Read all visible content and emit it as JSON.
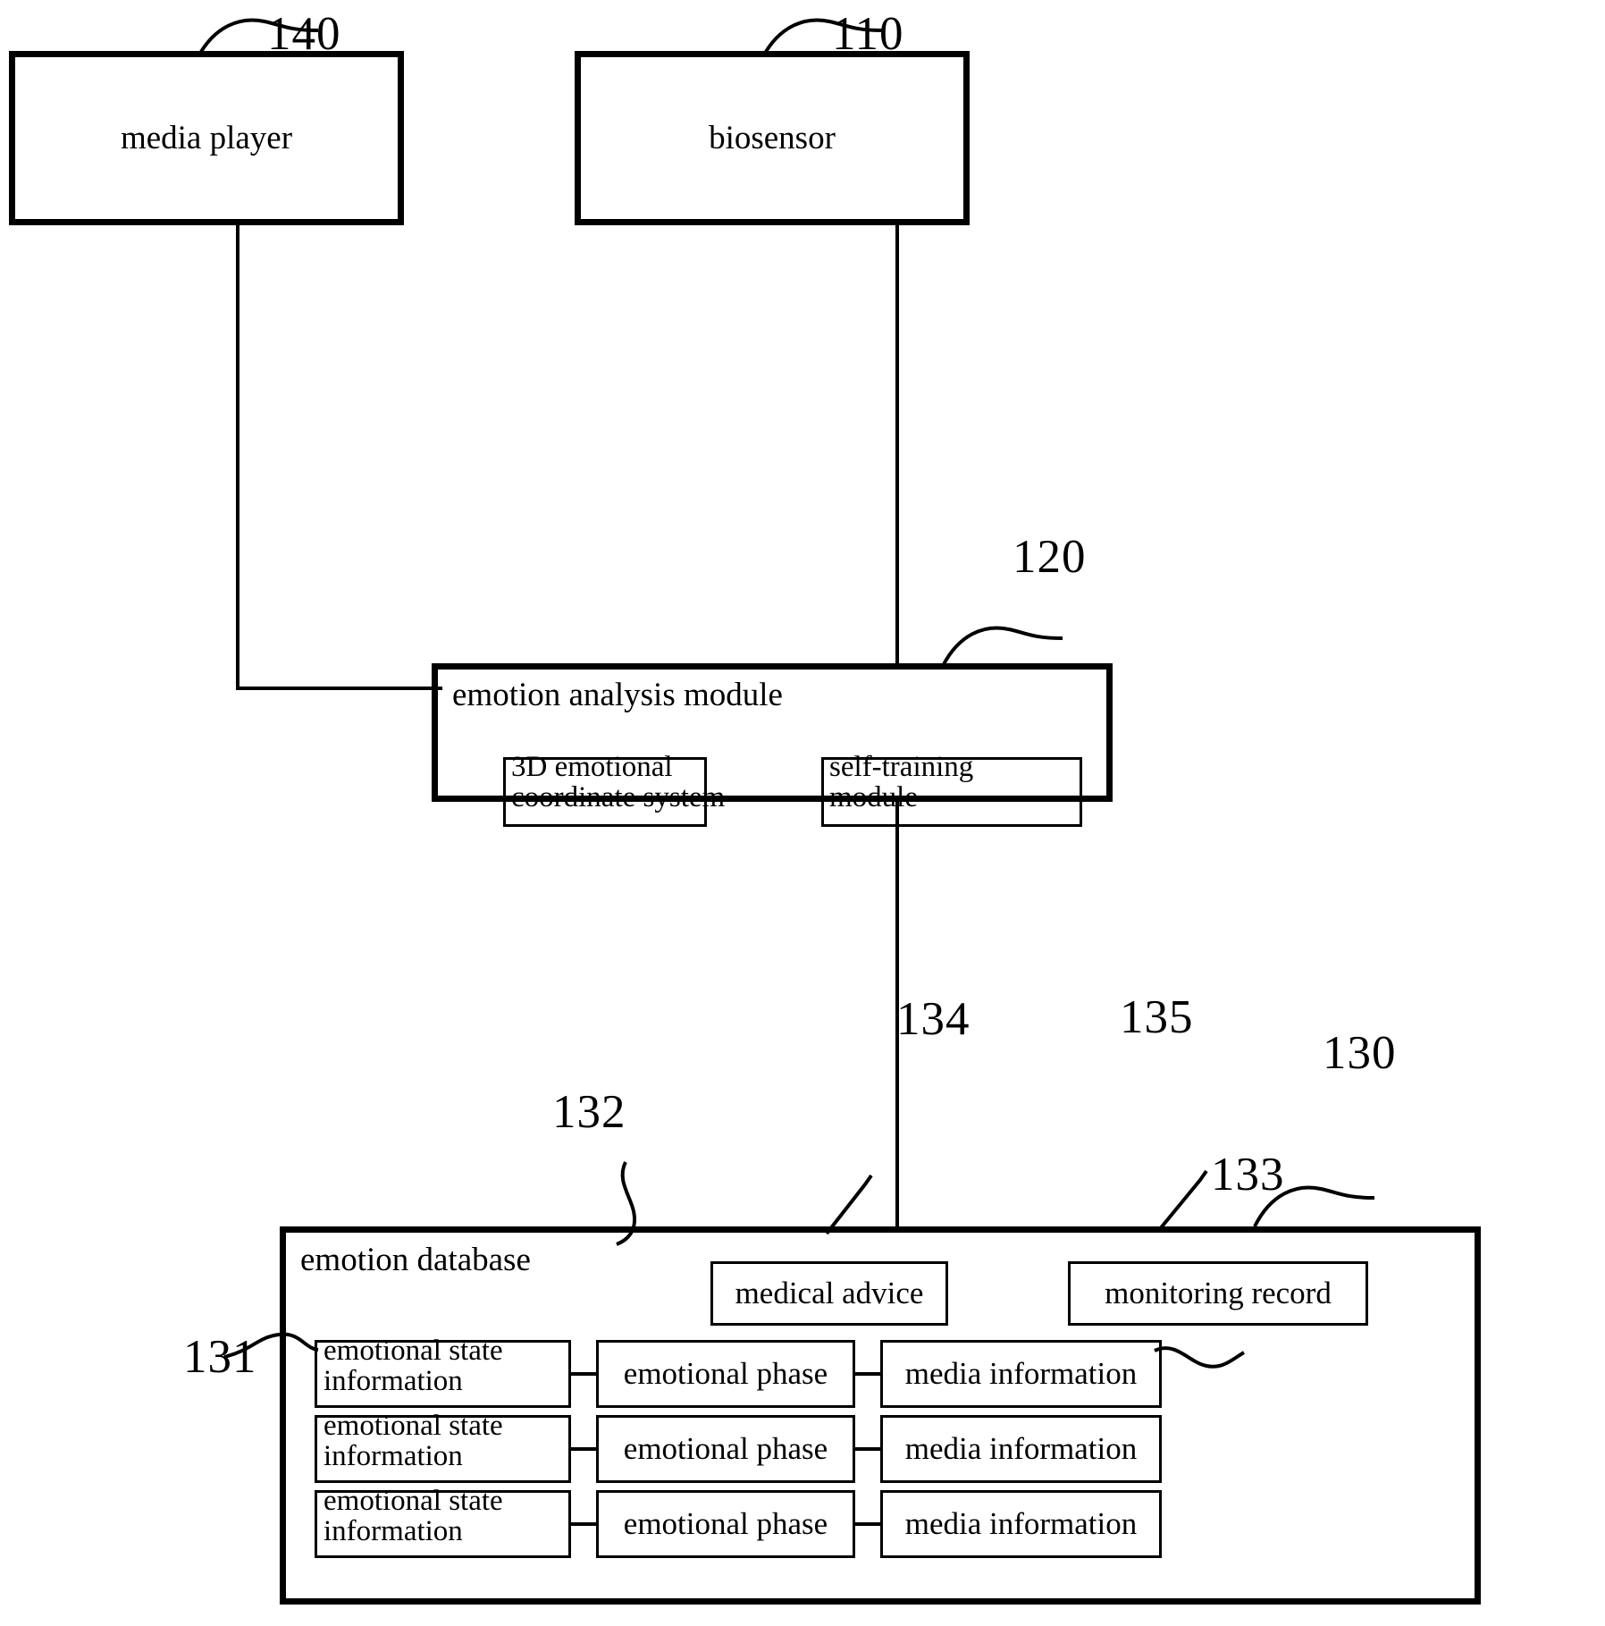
{
  "figure": {
    "type": "patent-block-diagram",
    "background": "#ffffff",
    "stroke": "#000000"
  },
  "blocks": {
    "media_player": {
      "label": "media player",
      "ref": "140"
    },
    "biosensor": {
      "label": "biosensor",
      "ref": "110"
    },
    "emotion_analysis_module": {
      "label": "emotion analysis module",
      "ref": "120",
      "sub_blocks": [
        {
          "label_line1": "3D emotional",
          "label_line2": "coordinate system"
        },
        {
          "label_line1": "self-training",
          "label_line2": "module"
        }
      ]
    },
    "emotion_database": {
      "label": "emotion database",
      "ref": "130",
      "medical_advice": {
        "label": "medical advice",
        "ref": "134"
      },
      "monitoring_record": {
        "label": "monitoring record",
        "ref": "135"
      },
      "column_refs": {
        "emotional_state_information": "131",
        "emotional_phase": "132",
        "media_information": "133"
      },
      "rows": [
        {
          "state_line1": "emotional state",
          "state_line2": "information",
          "phase": "emotional phase",
          "media": "media information"
        },
        {
          "state_line1": "emotional state",
          "state_line2": "information",
          "phase": "emotional phase",
          "media": "media information"
        },
        {
          "state_line1": "emotional state",
          "state_line2": "information",
          "phase": "emotional phase",
          "media": "media information"
        }
      ]
    }
  }
}
